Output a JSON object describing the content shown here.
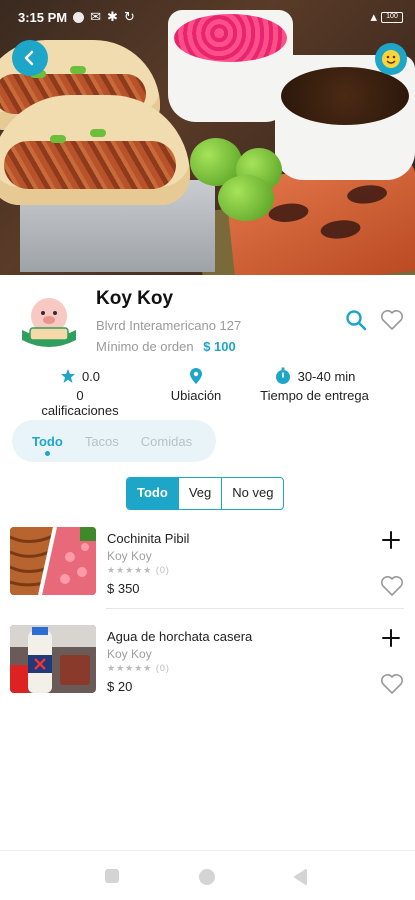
{
  "status_bar": {
    "time": "3:15 PM",
    "battery": "100"
  },
  "restaurant": {
    "name": "Koy Koy",
    "address": "Blvrd Interamericano 127",
    "min_order_label": "Mínimo de orden",
    "min_order_value": "$ 100",
    "logo_text_top": "cochinita",
    "logo_text_banner": "KOY KOY"
  },
  "stats": [
    {
      "icon": "star-icon",
      "value": "0.0",
      "label": "0 calificaciones"
    },
    {
      "icon": "location-pin-icon",
      "value": "",
      "label": "Ubiación"
    },
    {
      "icon": "timer-icon",
      "value": "30-40 min",
      "label": "Tiempo de entrega"
    }
  ],
  "category_tabs": [
    "Todo",
    "Tacos",
    "Comidas"
  ],
  "active_category": "Todo",
  "filters": [
    "Todo",
    "Veg",
    "No veg"
  ],
  "active_filter": "Todo",
  "items": [
    {
      "name": "Cochinita Pibil",
      "brand": "Koy Koy",
      "rating_count": "(0)",
      "price": "$ 350"
    },
    {
      "name": "Agua de horchata casera",
      "brand": "Koy Koy",
      "rating_count": "(0)",
      "price": "$ 20"
    }
  ],
  "colors": {
    "accent": "#1ea6c9",
    "muted": "#9a9a9a"
  }
}
